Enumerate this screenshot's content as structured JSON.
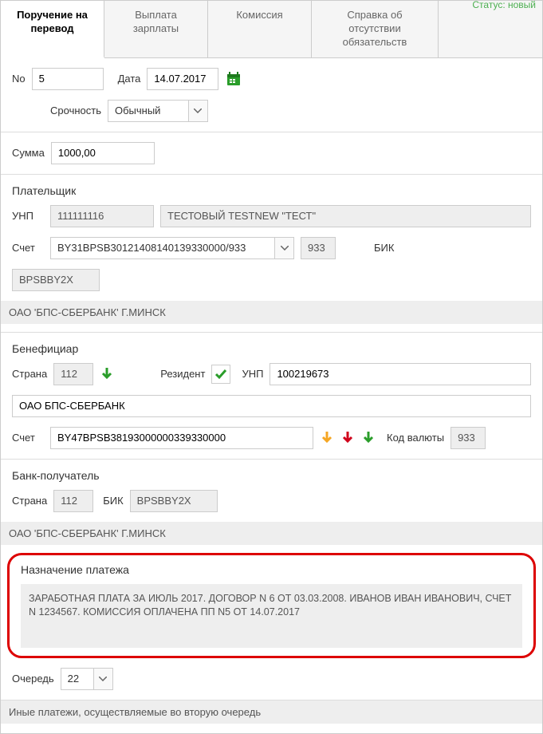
{
  "status": "Статус: новый",
  "tabs": {
    "t0": "Поручение на перевод",
    "t1": "Выплата зарплаты",
    "t2": "Комиссия",
    "t3": "Справка об отсутствии обязательств"
  },
  "header": {
    "no_label": "No",
    "no_value": "5",
    "date_label": "Дата",
    "date_value": "14.07.2017",
    "urgency_label": "Срочность",
    "urgency_value": "Обычный",
    "sum_label": "Сумма",
    "sum_value": "1000,00"
  },
  "payer": {
    "title": "Плательщик",
    "unp_label": "УНП",
    "unp_value": "111111116",
    "name_value": "ТЕСТОВЫЙ TESTNEW \"ТЕСТ\"",
    "account_label": "Счет",
    "account_value": "BY31BPSB30121408140139330000/933",
    "code_value": "933",
    "bik_label": "БИК",
    "bik_value": "BPSBBY2X",
    "bank_name": "ОАО 'БПС-СБЕРБАНК' Г.МИНСК"
  },
  "beneficiary": {
    "title": "Бенефициар",
    "country_label": "Страна",
    "country_value": "112",
    "resident_label": "Резидент",
    "unp_label": "УНП",
    "unp_value": "100219673",
    "name_value": "ОАО БПС-СБЕРБАНК",
    "account_label": "Счет",
    "account_value": "BY47BPSB38193000000339330000",
    "currency_label": "Код валюты",
    "currency_value": "933"
  },
  "recipient_bank": {
    "title": "Банк-получатель",
    "country_label": "Страна",
    "country_value": "112",
    "bik_label": "БИК",
    "bik_value": "BPSBBY2X",
    "bank_name": "ОАО 'БПС-СБЕРБАНК' Г.МИНСК"
  },
  "purpose": {
    "title": "Назначение платежа",
    "text": "ЗАРАБОТНАЯ ПЛАТА ЗА ИЮЛЬ 2017. ДОГОВОР N 6 ОТ 03.03.2008. ИВАНОВ ИВАН ИВАНОВИЧ, СЧЕТ N 1234567. КОМИССИЯ ОПЛАЧЕНА ПП N5 ОТ 14.07.2017"
  },
  "queue": {
    "label": "Очередь",
    "value": "22",
    "footer": "Иные платежи, осуществляемые во вторую очередь"
  }
}
